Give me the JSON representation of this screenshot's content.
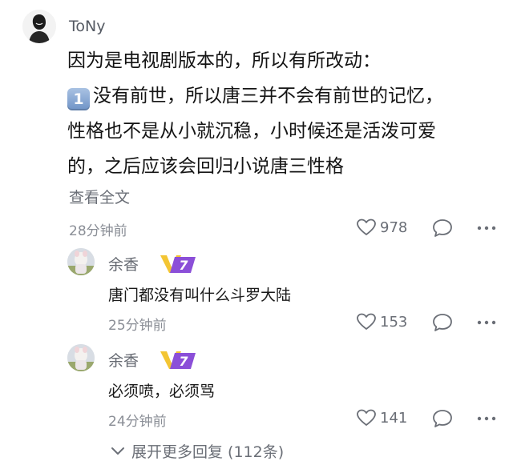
{
  "comment": {
    "username": "ToNy",
    "line1": "因为是电视剧版本的，所以有所改动：",
    "keycap": "1",
    "line2": "没有前世，所以唐三并不会有前世的记忆，",
    "line3": "性格也不是从小就沉稳，小时候还是活泼可爱",
    "line4": "的，之后应该会回归小说唐三性格",
    "see_all": "查看全文",
    "time": "28分钟前",
    "likes": "978",
    "icons": {
      "like": "heart-icon",
      "reply": "comment-bubble-icon",
      "more": "more-dots-icon"
    }
  },
  "replies": [
    {
      "name": "余香",
      "vip_level": "7",
      "text": "唐门都没有叫什么斗罗大陆",
      "time": "25分钟前",
      "likes": "153"
    },
    {
      "name": "余香",
      "vip_level": "7",
      "text": "必须喷，必须骂",
      "time": "24分钟前",
      "likes": "141"
    }
  ],
  "expand": {
    "label": "展开更多回复 (112条)",
    "icon": "chevron-down-icon"
  },
  "colors": {
    "vip_gold": "#f3c533",
    "vip_purple": "#8b4fd8",
    "meta_gray": "#8a8e96"
  }
}
